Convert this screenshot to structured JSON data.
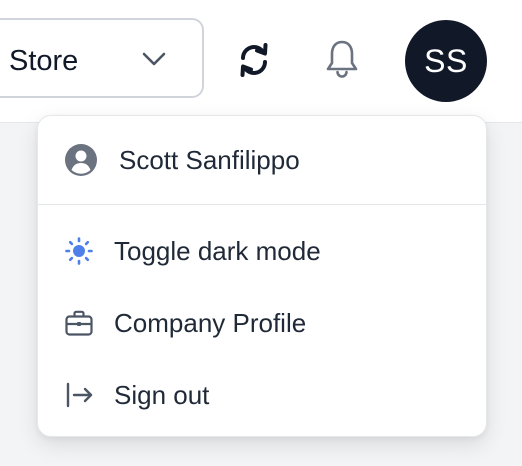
{
  "header": {
    "store_select": {
      "label": "Store",
      "icon": "chevron-down-icon"
    },
    "sync_icon": "sync-icon",
    "notifications_icon": "bell-icon",
    "avatar": {
      "initials": "SS",
      "background": "#111827"
    }
  },
  "user_menu": {
    "user_name": "Scott Sanfilippo",
    "user_icon": "user-circle-icon",
    "items": [
      {
        "label": "Toggle dark mode",
        "icon": "sun-icon",
        "icon_color": "#4f7fe8"
      },
      {
        "label": "Company Profile",
        "icon": "briefcase-icon"
      },
      {
        "label": "Sign out",
        "icon": "sign-out-icon"
      }
    ]
  }
}
